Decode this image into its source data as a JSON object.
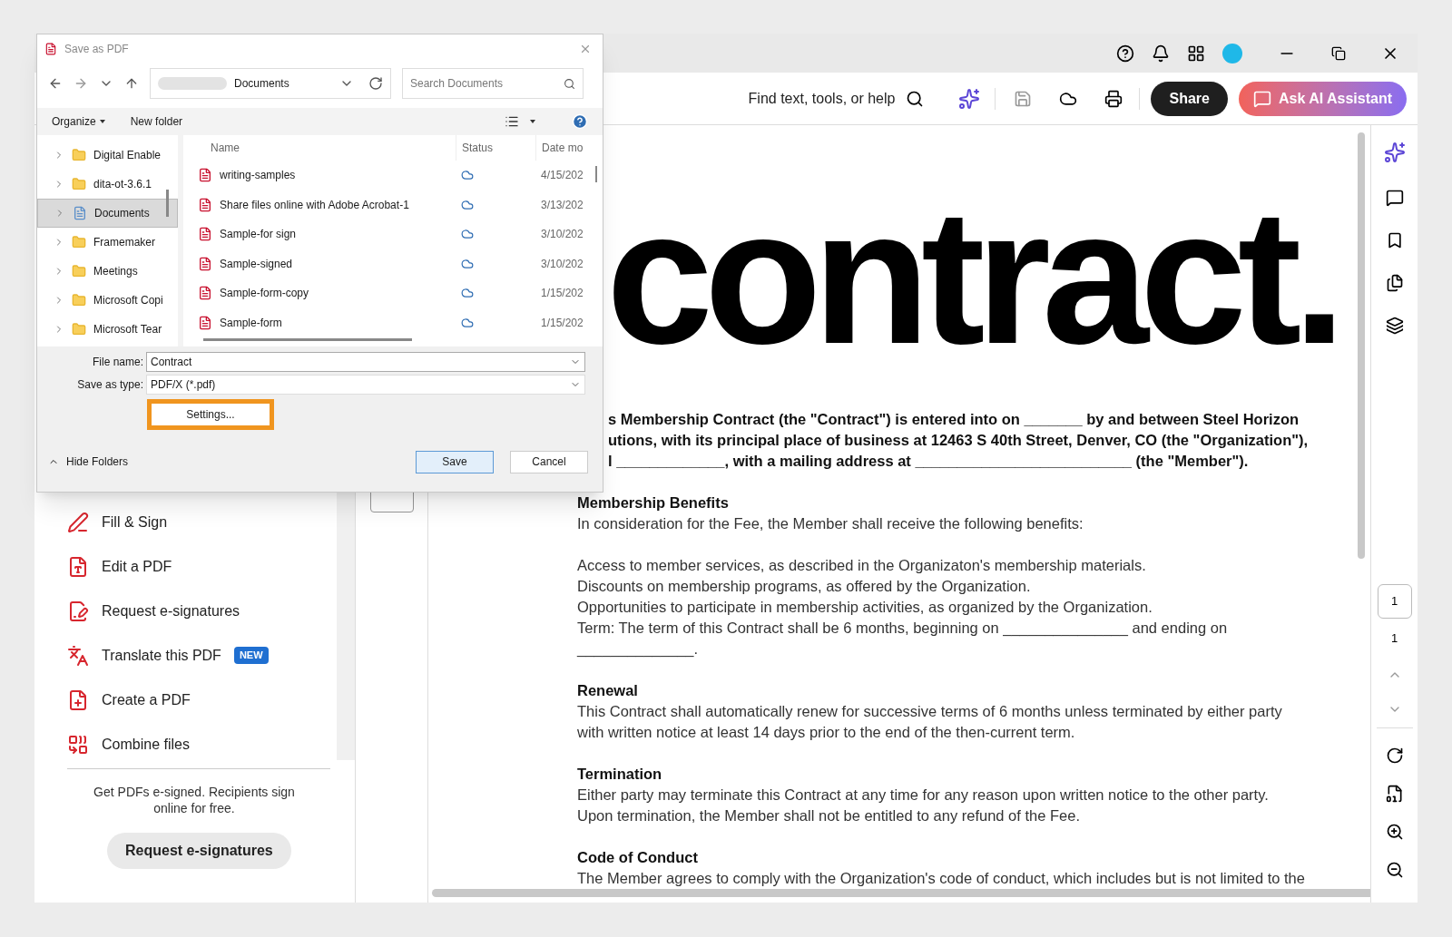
{
  "app": {
    "toolbar": {
      "search_label": "Find text, tools, or help",
      "share": "Share",
      "ai_button": "Ask AI Assistant"
    },
    "tools": [
      {
        "label": "Fill & Sign",
        "kind": "sign"
      },
      {
        "label": "Edit a PDF",
        "kind": "edit"
      },
      {
        "label": "Request e-signatures",
        "kind": "request"
      },
      {
        "label": "Translate this PDF",
        "kind": "translate",
        "badge": "NEW"
      },
      {
        "label": "Create a PDF",
        "kind": "create"
      },
      {
        "label": "Combine files",
        "kind": "combine"
      }
    ],
    "promo": "Get PDFs e-signed. Recipients sign online for free.",
    "promo_button": "Request e-signatures",
    "document": {
      "title": "contract.",
      "intro": [
        "s Membership Contract (the \"Contract\") is entered into on _______ by and between Steel Horizon",
        "utions, with its principal place of business at 12463 S 40th Street, Denver, CO (the \"Organization\"),",
        "l _____________, with a mailing address at __________________________ (the \"Member\")."
      ],
      "sections": [
        {
          "heading": "Membership Benefits",
          "paragraphs": [
            [
              "In consideration for the Fee, the Member shall receive the following benefits:"
            ],
            [
              "Access to member services, as described in the Organizaton's membership materials.",
              "Discounts on membership programs, as offered by the Organization.",
              "Opportunities to participate in membership activities, as organized by the Organization.",
              "Term: The term of this Contract shall be 6 months, beginning on _______________ and ending on",
              "______________."
            ]
          ]
        },
        {
          "heading": "Renewal",
          "paragraphs": [
            [
              "This Contract shall automatically renew for successive terms of 6 months unless terminated by either party",
              "with written notice at least 14 days prior to the end of the then-current term."
            ]
          ]
        },
        {
          "heading": "Termination",
          "paragraphs": [
            [
              "Either party may terminate this Contract at any time for any reason upon written notice to the other party.",
              "Upon termination, the Member shall not be entitled to any refund of the Fee."
            ]
          ]
        },
        {
          "heading": "Code of Conduct",
          "paragraphs": [
            [
              "The Member agrees to comply with the Organization's code of conduct, which includes but is not limited to the"
            ]
          ]
        }
      ]
    },
    "page": {
      "current": "1",
      "total": "1"
    }
  },
  "dialog": {
    "title": "Save as PDF",
    "address": "Documents",
    "search_placeholder": "Search Documents",
    "commands": [
      "Organize",
      "New folder"
    ],
    "folders": [
      {
        "label": "Digital Enable",
        "kind": "shortcut",
        "selected": false
      },
      {
        "label": "dita-ot-3.6.1",
        "kind": "folder",
        "selected": false
      },
      {
        "label": "Documents",
        "kind": "library",
        "selected": true
      },
      {
        "label": "Framemaker",
        "kind": "folder",
        "selected": false
      },
      {
        "label": "Meetings",
        "kind": "folder",
        "selected": false
      },
      {
        "label": "Microsoft Copi",
        "kind": "folder",
        "selected": false
      },
      {
        "label": "Microsoft Tear",
        "kind": "folder",
        "selected": false
      }
    ],
    "columns": [
      "Name",
      "Status",
      "Date mo"
    ],
    "files": [
      {
        "name": "writing-samples",
        "date": "4/15/202"
      },
      {
        "name": "Share files online with Adobe Acrobat-1",
        "date": "3/13/202"
      },
      {
        "name": "Sample-for sign",
        "date": "3/10/202"
      },
      {
        "name": "Sample-signed",
        "date": "3/10/202"
      },
      {
        "name": "Sample-form-copy",
        "date": "1/15/202"
      },
      {
        "name": "Sample-form",
        "date": "1/15/202"
      }
    ],
    "file_name_label": "File name:",
    "file_name": "Contract",
    "type_label": "Save as type:",
    "type_value": "PDF/X (*.pdf)",
    "settings_button": "Settings...",
    "hide_folders": "Hide Folders",
    "buttons": [
      {
        "label": "Save",
        "primary": true
      },
      {
        "label": "Cancel",
        "primary": false
      }
    ]
  }
}
